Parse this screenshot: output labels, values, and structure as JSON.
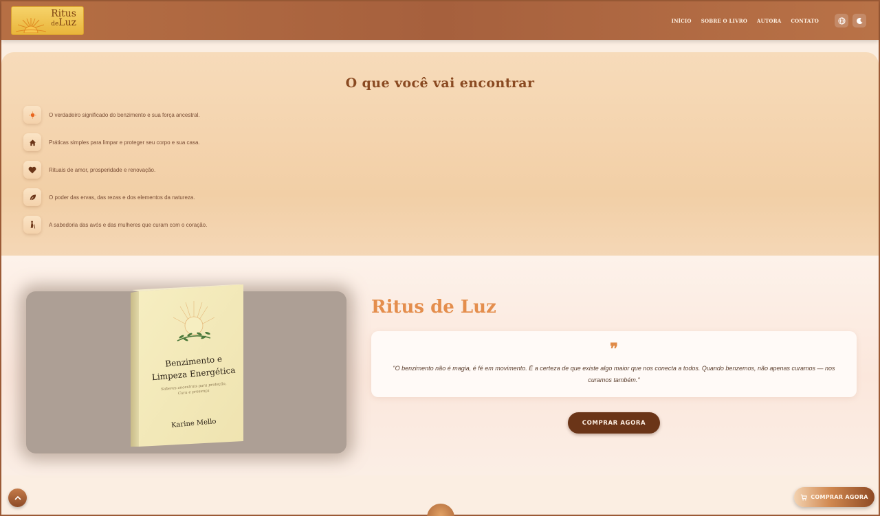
{
  "brand": {
    "logo_line1": "Ritus",
    "logo_line2_prefix": "de",
    "logo_line2": "Luz"
  },
  "nav": {
    "links": [
      "INÍCIO",
      "SOBRE O LIVRO",
      "AUTORA",
      "CONTATO"
    ],
    "icons": [
      "globe-icon",
      "moon-icon"
    ]
  },
  "features": {
    "title": "O que você vai encontrar",
    "items": [
      {
        "icon": "sun-icon",
        "text": "O verdadeiro significado do benzimento e sua força ancestral."
      },
      {
        "icon": "home-icon",
        "text": "Práticas simples para limpar e proteger seu corpo e sua casa."
      },
      {
        "icon": "heart-icon",
        "text": "Rituais de amor, prosperidade e renovação."
      },
      {
        "icon": "leaf-icon",
        "text": "O poder das ervas, das rezas e dos elementos da natureza."
      },
      {
        "icon": "elder-icon",
        "text": "A sabedoria das avós e das mulheres que curam com o coração."
      }
    ]
  },
  "book": {
    "cover_title_line1": "Benzimento e",
    "cover_title_line2": "Limpeza Energética",
    "cover_subtitle_line1": "Saberes ancestrais para proteção,",
    "cover_subtitle_line2": "Cura e presença",
    "cover_author": "Karine Mello"
  },
  "product": {
    "title": "Ritus de Luz",
    "quote_mark": "❞",
    "quote": "\"O benzimento não é magia, é fé em movimento. É a certeza de que existe algo maior que nos conecta a todos. Quando benzemos, não apenas curamos — nos curamos também.\"",
    "buy_label": "COMPRAR AGORA"
  },
  "floating": {
    "buy_label": "COMPRAR AGORA"
  },
  "colors": {
    "accent": "#e48e4d",
    "brown": "#6b3518",
    "nav": "#a6603d"
  }
}
